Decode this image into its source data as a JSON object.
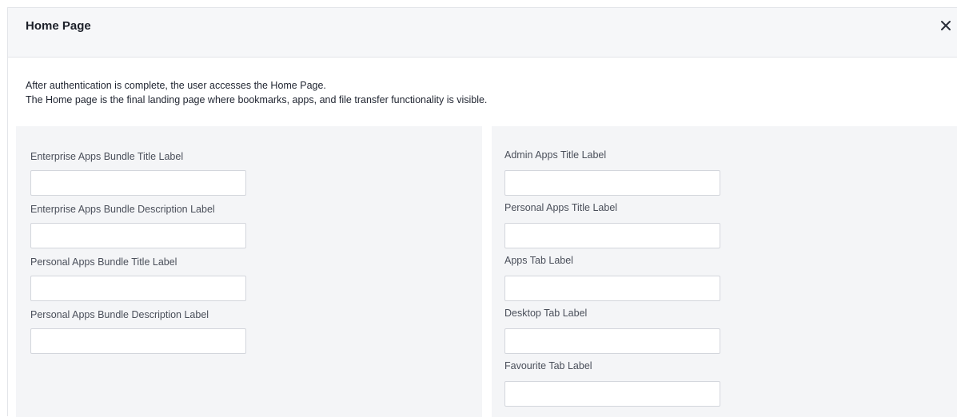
{
  "dialog": {
    "title": "Home Page",
    "close_icon": "close-icon",
    "intro_line1": "After authentication is complete, the user accesses the Home Page.",
    "intro_line2": "The Home page is the final landing page where bookmarks, apps, and file transfer functionality is visible."
  },
  "left_fields": [
    {
      "label": "Enterprise Apps Bundle Title Label",
      "value": ""
    },
    {
      "label": "Enterprise Apps Bundle Description Label",
      "value": ""
    },
    {
      "label": "Personal Apps Bundle Title Label",
      "value": ""
    },
    {
      "label": "Personal Apps Bundle Description Label",
      "value": ""
    }
  ],
  "right_fields": [
    {
      "label": "Admin Apps Title Label",
      "value": ""
    },
    {
      "label": "Personal Apps Title Label",
      "value": ""
    },
    {
      "label": "Apps Tab Label",
      "value": ""
    },
    {
      "label": "Desktop Tab Label",
      "value": ""
    },
    {
      "label": "Favourite Tab Label",
      "value": ""
    }
  ]
}
